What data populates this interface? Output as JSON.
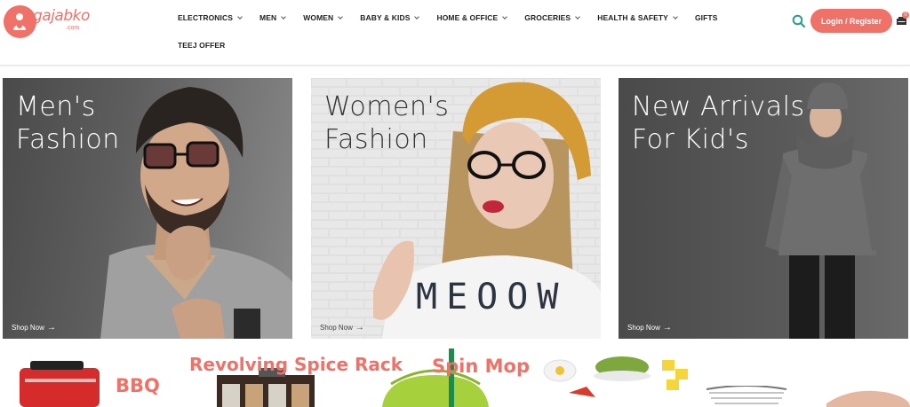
{
  "brand": {
    "name": "gajabko",
    "domain": ".com",
    "color": "#f07167"
  },
  "nav": {
    "row1": [
      {
        "label": "ELECTRONICS",
        "has_dropdown": true
      },
      {
        "label": "MEN",
        "has_dropdown": true
      },
      {
        "label": "WOMEN",
        "has_dropdown": true
      },
      {
        "label": "BABY & KIDS",
        "has_dropdown": true
      },
      {
        "label": "HOME & OFFICE",
        "has_dropdown": true
      },
      {
        "label": "GROCERIES",
        "has_dropdown": true
      },
      {
        "label": "HEALTH & SAFETY",
        "has_dropdown": true
      },
      {
        "label": "GIFTS",
        "has_dropdown": false
      }
    ],
    "row2": [
      {
        "label": "TEEJ OFFER",
        "has_dropdown": false
      }
    ]
  },
  "header": {
    "search_icon": "search-icon",
    "login_label": "Login / Register",
    "cart_icon": "cart-icon",
    "cart_count": "0"
  },
  "banners": [
    {
      "title_line1": "Men's",
      "title_line2": "Fashion",
      "cta": "Shop Now"
    },
    {
      "title_line1": "Women's",
      "title_line2": "Fashion",
      "shirt_text": "MEOOW",
      "cta": "Shop Now"
    },
    {
      "title_line1": "New Arrivals",
      "title_line2": "For Kid's",
      "cta": "Shop Now"
    }
  ],
  "promos": [
    {
      "label": "BBQ"
    },
    {
      "label": "Revolving Spice Rack"
    },
    {
      "label": "Spin Mop"
    }
  ]
}
